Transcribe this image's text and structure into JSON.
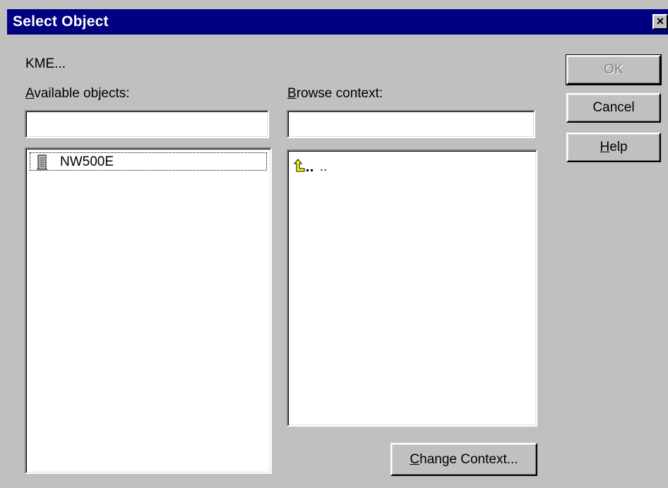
{
  "dialog": {
    "title": "Select Object",
    "close_glyph": "×"
  },
  "context_label": "KME...",
  "available": {
    "label_mnemonic": "A",
    "label_rest": "vailable objects:",
    "filter_value": "",
    "items": [
      {
        "label": "NW500E",
        "icon": "server-icon"
      }
    ]
  },
  "browse": {
    "label_mnemonic": "B",
    "label_rest": "rowse context:",
    "filter_value": "",
    "items": [
      {
        "label": "..",
        "icon": "parent-folder-icon"
      }
    ]
  },
  "buttons": {
    "ok": "OK",
    "cancel": "Cancel",
    "help_mnemonic": "H",
    "help_rest": "elp",
    "change_context_mnemonic": "C",
    "change_context_rest": "hange Context..."
  },
  "colors": {
    "titlebar": "#000080",
    "face": "#c0c0c0"
  }
}
